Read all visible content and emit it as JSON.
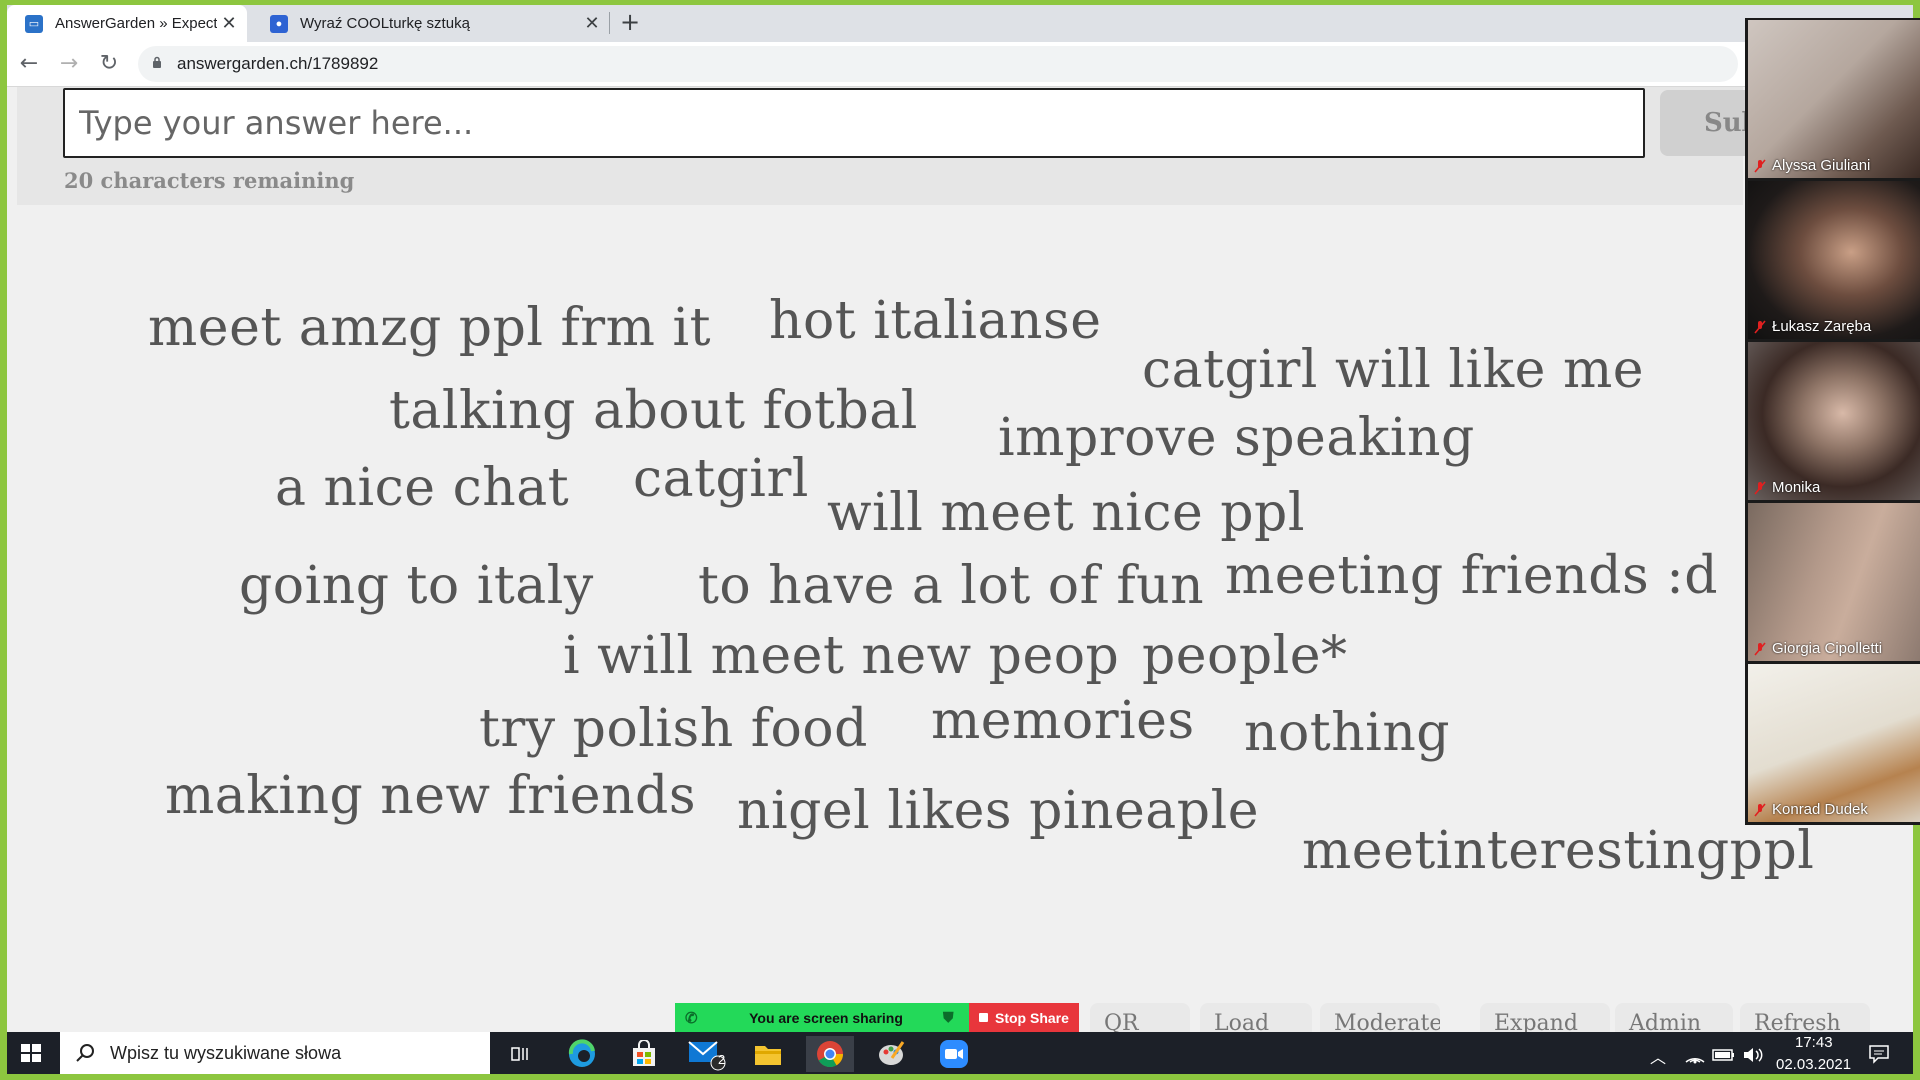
{
  "browser": {
    "tabs": [
      {
        "title": "AnswerGarden » Expectations...",
        "active": true
      },
      {
        "title": "Wyraź COOLturkę sztuką",
        "active": false
      }
    ],
    "url": "answergarden.ch/1789892"
  },
  "answer_form": {
    "placeholder": "Type your answer here...",
    "submit_label": "Submit",
    "remaining_text": "20 characters remaining"
  },
  "cloud_words": [
    "meet amzg ppl frm it",
    "hot italianse",
    "catgirl will like me",
    "talking about fotbal",
    "improve speaking",
    "a nice chat",
    "catgirl",
    "will meet nice ppl",
    "going to italy",
    "to have a lot of fun",
    "meeting friends :d",
    "i will meet new peop",
    "people*",
    "try polish food",
    "memories",
    "nothing",
    "making new friends",
    "nigel likes pineaple",
    "meetinterestingppl"
  ],
  "bottom_tabs": [
    "QR",
    "Load",
    "Moderate",
    "Expand",
    "Admin",
    "Refresh"
  ],
  "zoom": {
    "share_status": "You are screen sharing",
    "stop_share": "Stop Share",
    "participants": [
      "Alyssa Giuliani",
      "Łukasz Zaręba",
      "Monika",
      "Giorgia Cipolletti",
      "Konrad Dudek"
    ]
  },
  "taskbar": {
    "search_placeholder": "Wpisz tu wyszukiwane słowa",
    "mail_badge": "2",
    "time": "17:43",
    "date": "02.03.2021"
  }
}
